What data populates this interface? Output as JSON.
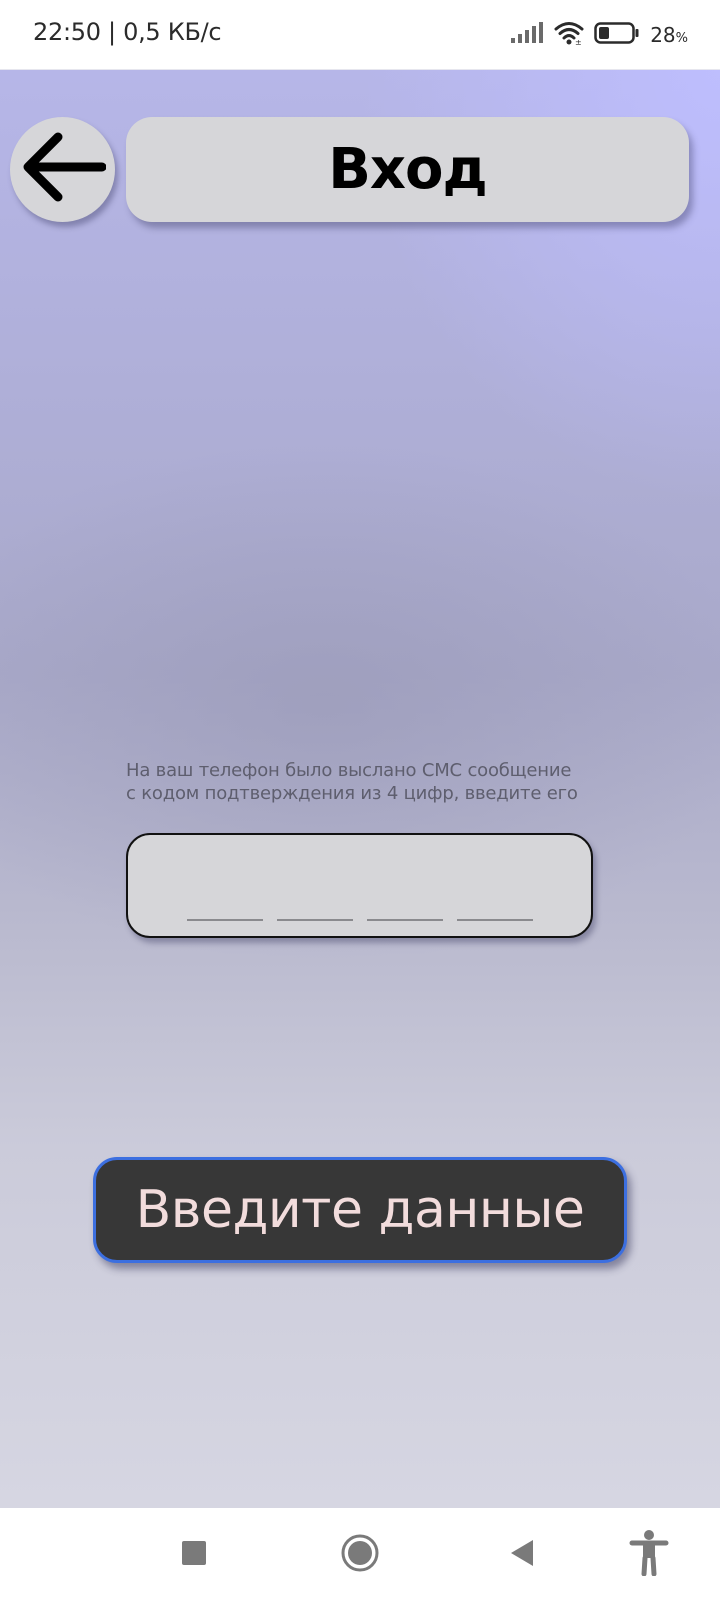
{
  "status_bar": {
    "time_speed": "22:50 | 0,5 КБ/с",
    "battery": "28",
    "battery_unit": "%",
    "icons": [
      "signal-icon",
      "wifi-icon",
      "battery-icon"
    ]
  },
  "header": {
    "back_icon": "arrow-left-icon",
    "title": "Вход"
  },
  "sms_prompt": {
    "line1": "На ваш телефон было выслано СМС сообщение",
    "line2": "с кодом подтверждения из 4 цифр, введите его"
  },
  "code_input": {
    "digits": [
      "",
      "",
      "",
      ""
    ]
  },
  "submit": {
    "label": "Введите данные"
  },
  "nav_bar": {
    "icons": [
      "recent-apps-square-icon",
      "home-circle-icon",
      "back-triangle-icon",
      "accessibility-icon"
    ]
  },
  "colors": {
    "panel": "#d6d6d9",
    "button_bg": "#373737",
    "button_border": "#3c6fe0",
    "button_text": "#f2dcdc",
    "background_top": "#b6b6e8",
    "background_bottom": "#d6d6e2"
  }
}
